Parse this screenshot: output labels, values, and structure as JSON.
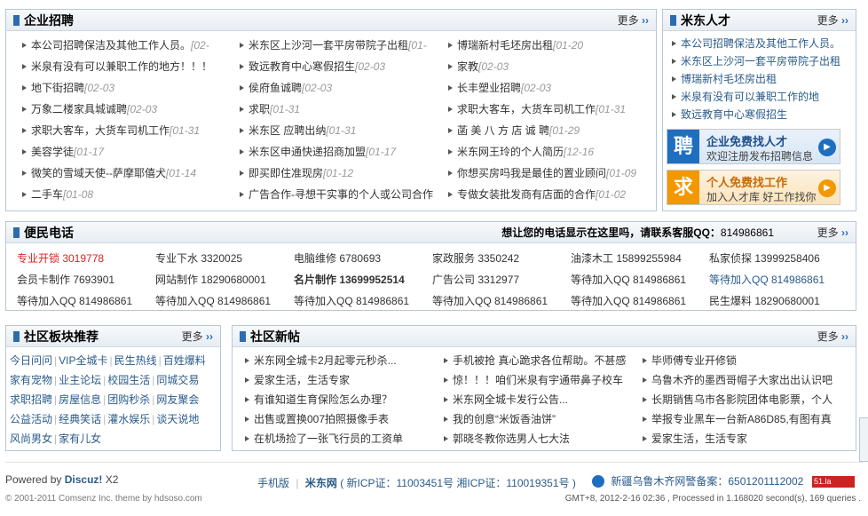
{
  "jobs": {
    "title": "企业招聘",
    "more": "更多",
    "items": [
      [
        "本公司招聘保洁及其他工作人员。",
        "02-"
      ],
      [
        "米东区上沙河一套平房带院子出租",
        "01-"
      ],
      [
        "博瑞新村毛坯房出租",
        "01-20"
      ],
      [
        "米泉有没有可以兼职工作的地方！！！",
        ""
      ],
      [
        "致远教育中心寒假招生",
        "02-03"
      ],
      [
        "家教",
        "02-03"
      ],
      [
        "地下街招聘",
        "02-03"
      ],
      [
        "侯府鱼诚聘",
        "02-03"
      ],
      [
        "长丰塑业招聘",
        "02-03"
      ],
      [
        "万象二楼家具城诚聘",
        "02-03"
      ],
      [
        "求职",
        "01-31"
      ],
      [
        "求职大客车，大货车司机工作",
        "01-31"
      ],
      [
        "求职大客车，大货车司机工作",
        "01-31"
      ],
      [
        "米东区 应聘出纳",
        "01-31"
      ],
      [
        "菡 美 八 方 店 诚 聘",
        "01-29"
      ],
      [
        "美容学徒",
        "01-17"
      ],
      [
        "米东区申通快递招商加盟",
        "01-17"
      ],
      [
        "米东网王玲的个人简历",
        "12-16"
      ],
      [
        "微笑的雪域天使--萨摩耶僖犬",
        "01-14"
      ],
      [
        "即买即住准现房",
        "01-12"
      ],
      [
        "你想买房吗我是最佳的置业顾问",
        "01-09"
      ],
      [
        "二手车",
        "01-08"
      ],
      [
        "广告合作-寻想干实事的个人或公司合作",
        ""
      ],
      [
        "专做女装批发商有店面的合作",
        "01-02"
      ]
    ]
  },
  "talent": {
    "title": "米东人才",
    "more": "更多",
    "items": [
      "本公司招聘保洁及其他工作人员。",
      "米东区上沙河一套平房带院子出租",
      "博瑞新村毛坯房出租",
      "米泉有没有可以兼职工作的地",
      "致远教育中心寒假招生"
    ],
    "promo1": {
      "icon": "聘",
      "t1": "企业免费找人才",
      "t2": "欢迎注册发布招聘信息"
    },
    "promo2": {
      "icon": "求",
      "t1": "个人免费找工作",
      "t2": "加入人才库 好工作找你"
    }
  },
  "phones": {
    "title": "便民电话",
    "msg_a": "想让您的电话显示在这里吗，请联系客服QQ：",
    "msg_b": "814986861",
    "more": "更多",
    "rows": [
      [
        "专业开锁 3019778",
        "专业下水 3320025",
        "电脑维修 6780693",
        "家政服务 3350242",
        "油漆木工 15899255984",
        "私家侦探 13999258406"
      ],
      [
        "会员卡制作 7693901",
        "网站制作 18290680001",
        "名片制作 13699952514",
        "广告公司 3312977",
        "等待加入QQ 814986861",
        "等待加入QQ 814986861"
      ],
      [
        "等待加入QQ 814986861",
        "等待加入QQ 814986861",
        "等待加入QQ 814986861",
        "等待加入QQ 814986861",
        "等待加入QQ 814986861",
        "民生爆料 18290680001"
      ]
    ]
  },
  "boards": {
    "title": "社区板块推荐",
    "more": "更多",
    "rows": [
      [
        "今日问问",
        "VIP全城卡",
        "民生热线",
        "百姓爆料"
      ],
      [
        "家有宠物",
        "业主论坛",
        "校园生活",
        "同城交易"
      ],
      [
        "求职招聘",
        "房屋信息",
        "团购秒杀",
        "网友聚会"
      ],
      [
        "公益活动",
        "经典笑话",
        "灌水娱乐",
        "谈天说地"
      ],
      [
        "风尚男女",
        "家有儿女"
      ]
    ]
  },
  "posts": {
    "title": "社区新帖",
    "more": "更多",
    "items": [
      [
        "米东网全城卡2月起零元秒杀...",
        "手机被抢 真心跪求各位帮助。不甚感",
        "毕师傅专业开修锁"
      ],
      [
        "爱家生活，生活专家",
        "惊！！！咱们米泉有宇通带鼻子校车",
        "乌鲁木齐的墨西哥帽子大家出出认识吧"
      ],
      [
        "有谁知道生育保险怎么办理？",
        "米东网全城卡发行公告...",
        "长期销售乌市各影院团体电影票，个人"
      ],
      [
        "出售或置换007拍照摄像手表",
        "我的创意“米饭香油饼”",
        "举报专业黑车一台新A86D85,有图有真"
      ],
      [
        "在机场捡了一张飞行员的工资单",
        "郭晓冬教你选男人七大法",
        "爱家生活，生活专家"
      ]
    ]
  },
  "footer": {
    "powered": "Powered by",
    "brand": "Discuz!",
    "ver": "X2",
    "copy": "© 2001-2011 Comsenz Inc. theme by hdsoso.com",
    "mobile": "手机版",
    "site": "米东网",
    "icp": "( 新ICP证：11003451号 湘ICP证：110019351号 )",
    "police": "新疆乌鲁木齐网警备案：6501201112002",
    "badge": "51.la",
    "gmt": "GMT+8, 2012-2-16 02:36 , Processed in 1.168020 second(s), 169 queries ."
  },
  "colors": {
    "accent": "#2b6cb0",
    "link": "#2a5b8a",
    "red": "#dd2222",
    "promo_blue": "#1f6fc0",
    "promo_orange": "#f39800"
  }
}
